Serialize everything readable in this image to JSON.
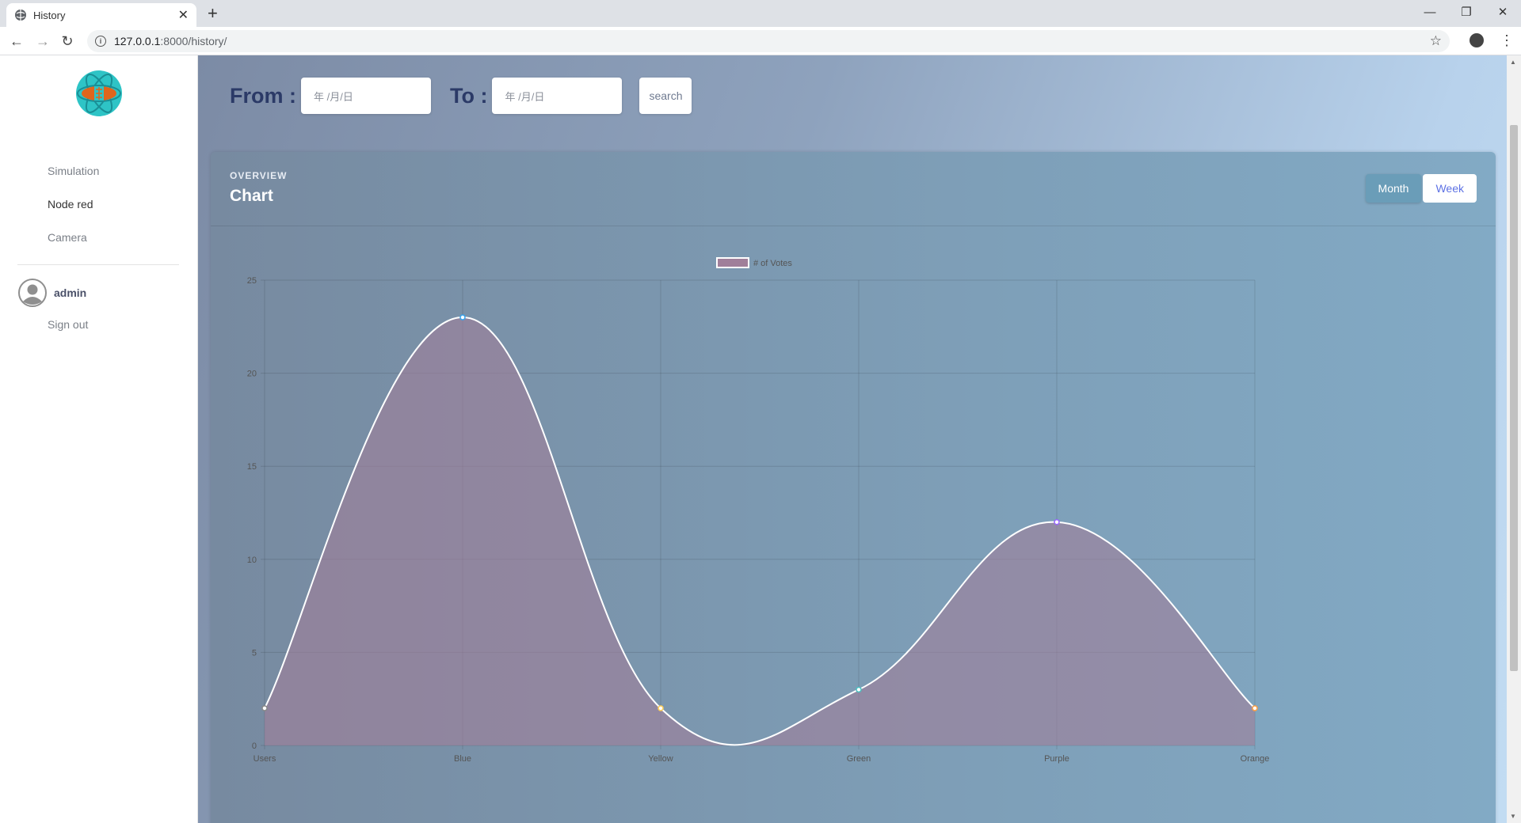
{
  "browser": {
    "tab_title": "History",
    "url_host": "127.0.0.1",
    "url_rest": ":8000/history/"
  },
  "sidebar": {
    "items": [
      {
        "label": "Simulation"
      },
      {
        "label": "Node red"
      },
      {
        "label": "Camera"
      }
    ],
    "user_name": "admin",
    "signout": "Sign out"
  },
  "filters": {
    "from_label": "From :",
    "to_label": "To :",
    "from_placeholder": "年 /月/日",
    "to_placeholder": "年 /月/日",
    "search_label": "search"
  },
  "card": {
    "overline": "OVERVIEW",
    "title": "Chart",
    "month_label": "Month",
    "week_label": "Week"
  },
  "chart_data": {
    "type": "line",
    "categories": [
      "Users",
      "Blue",
      "Yellow",
      "Green",
      "Purple",
      "Orange"
    ],
    "series": [
      {
        "name": "# of Votes",
        "values": [
          2,
          23,
          2,
          3,
          12,
          2
        ]
      }
    ],
    "point_colors": [
      "#ffffff",
      "#36a2eb",
      "#ffce56",
      "#4bc0c0",
      "#9966ff",
      "#ff9f40"
    ],
    "ylim": [
      0,
      25
    ],
    "yticks": [
      0,
      5,
      10,
      15,
      20,
      25
    ],
    "legend": "top",
    "grid": true,
    "fill_color": "#a07f9a",
    "line_color": "#ffffff"
  }
}
